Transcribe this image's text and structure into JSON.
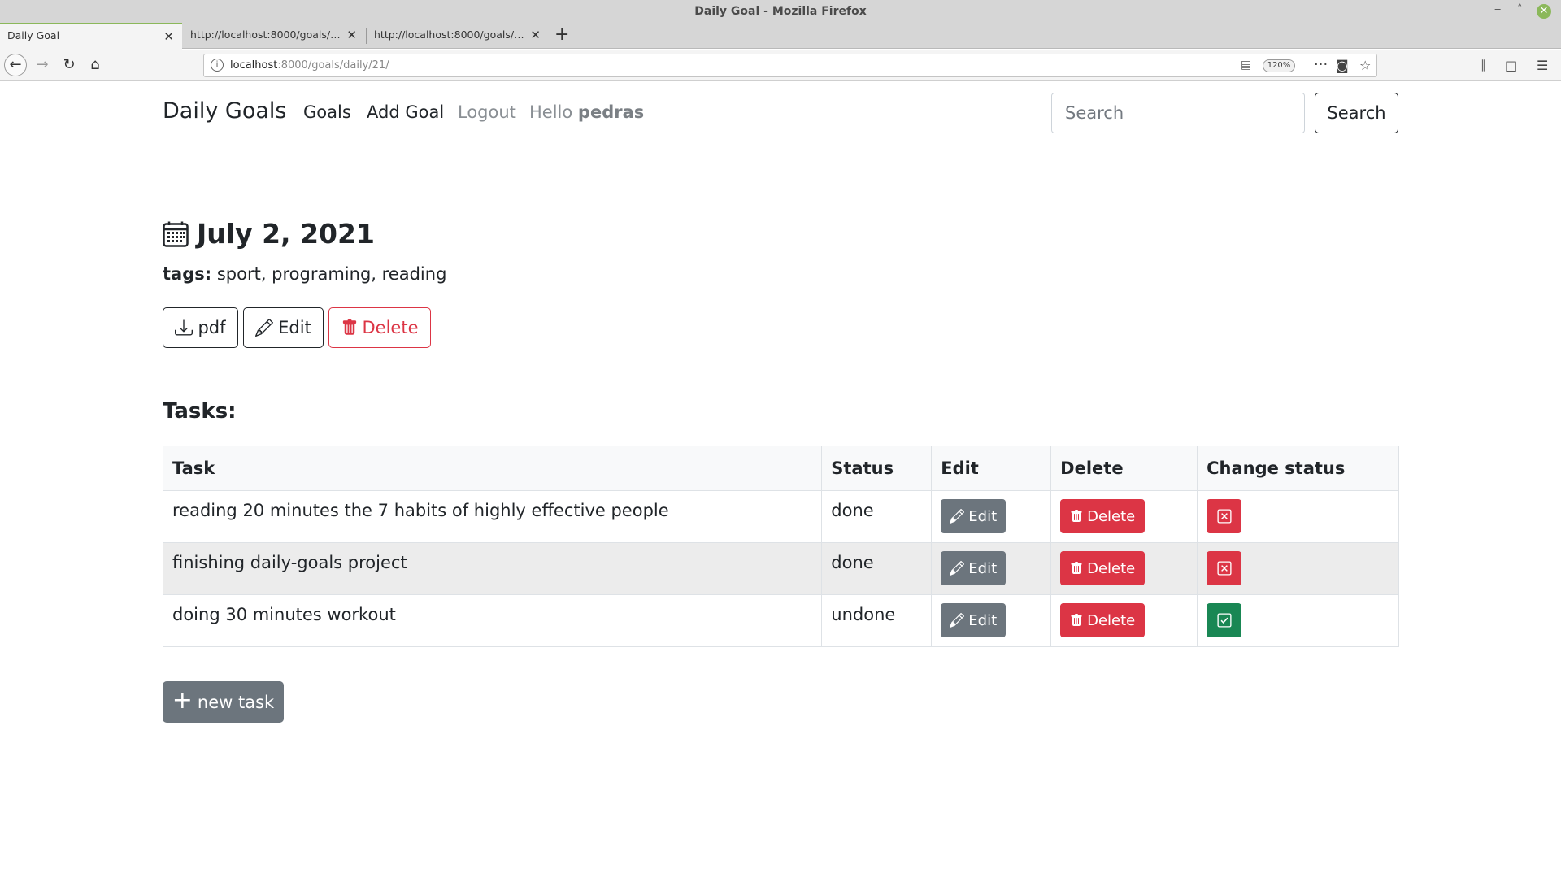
{
  "browser": {
    "window_title": "Daily Goal - Mozilla Firefox",
    "tabs": [
      {
        "label": "Daily Goal"
      },
      {
        "label": "http://localhost:8000/goals/daily/"
      },
      {
        "label": "http://localhost:8000/goals/daily/"
      }
    ],
    "url_host": "localhost",
    "url_path": ":8000/goals/daily/21/",
    "zoom": "120%"
  },
  "nav": {
    "brand": "Daily Goals",
    "goals": "Goals",
    "add_goal": "Add Goal",
    "logout": "Logout",
    "hello": "Hello",
    "username": "pedras",
    "search_placeholder": "Search",
    "search_button": "Search"
  },
  "goal": {
    "date": "July 2, 2021",
    "tags_label": "tags:",
    "tags": "sport, programing, reading",
    "pdf_label": "pdf",
    "edit_label": "Edit",
    "delete_label": "Delete"
  },
  "tasks": {
    "heading": "Tasks:",
    "columns": [
      "Task",
      "Status",
      "Edit",
      "Delete",
      "Change status"
    ],
    "rows": [
      {
        "task": "reading 20 minutes the 7 habits of highly effective people",
        "status": "done",
        "edit": "Edit",
        "delete": "Delete",
        "change_icon": "x-square-icon"
      },
      {
        "task": "finishing daily-goals project",
        "status": "done",
        "edit": "Edit",
        "delete": "Delete",
        "change_icon": "x-square-icon"
      },
      {
        "task": "doing 30 minutes workout",
        "status": "undone",
        "edit": "Edit",
        "delete": "Delete",
        "change_icon": "check-square-icon"
      }
    ],
    "new_task": "new task"
  },
  "colors": {
    "danger": "#dc3545",
    "secondary": "#6c757d",
    "success": "#198754"
  }
}
